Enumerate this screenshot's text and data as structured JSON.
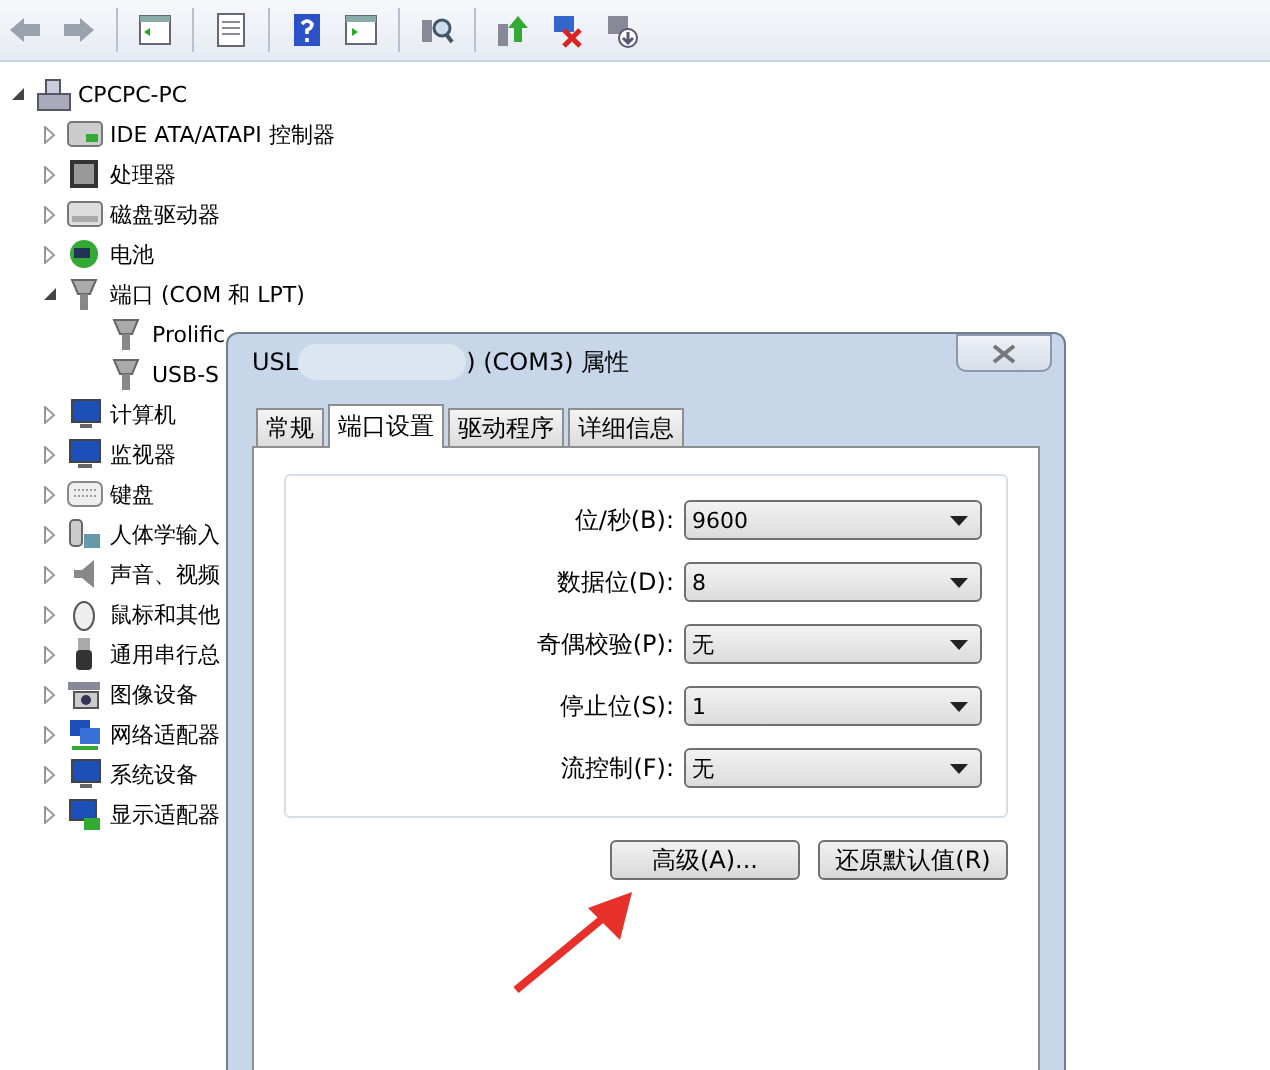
{
  "tree": {
    "label": "CPCPC-PC",
    "expanded": true,
    "children": [
      {
        "label": "IDE ATA/ATAPI 控制器",
        "expanded": false
      },
      {
        "label": "处理器",
        "expanded": false
      },
      {
        "label": "磁盘驱动器",
        "expanded": false
      },
      {
        "label": "电池",
        "expanded": false
      },
      {
        "label": "端口 (COM 和 LPT)",
        "expanded": true,
        "children": [
          {
            "label": "Prolific"
          },
          {
            "label": "USB-S"
          }
        ]
      },
      {
        "label": "计算机",
        "expanded": false
      },
      {
        "label": "监视器",
        "expanded": false
      },
      {
        "label": "键盘",
        "expanded": false
      },
      {
        "label": "人体学输入",
        "expanded": false
      },
      {
        "label": "声音、视频",
        "expanded": false
      },
      {
        "label": "鼠标和其他",
        "expanded": false
      },
      {
        "label": "通用串行总",
        "expanded": false
      },
      {
        "label": "图像设备",
        "expanded": false
      },
      {
        "label": "网络适配器",
        "expanded": false
      },
      {
        "label": "系统设备",
        "expanded": false
      },
      {
        "label": "显示适配器",
        "expanded": false
      }
    ]
  },
  "dialog": {
    "title_start": "USL",
    "title_end": ") (COM3) 属性",
    "tabs": [
      {
        "label": "常规",
        "selected": false
      },
      {
        "label": "端口设置",
        "selected": true
      },
      {
        "label": "驱动程序",
        "selected": false
      },
      {
        "label": "详细信息",
        "selected": false
      }
    ],
    "settings": [
      {
        "label": "位/秒(B):",
        "value": "9600"
      },
      {
        "label": "数据位(D):",
        "value": "8"
      },
      {
        "label": "奇偶校验(P):",
        "value": "无"
      },
      {
        "label": "停止位(S):",
        "value": "1"
      },
      {
        "label": "流控制(F):",
        "value": "无"
      }
    ],
    "buttons": [
      "高级(A)...",
      "还原默认值(R)"
    ]
  }
}
